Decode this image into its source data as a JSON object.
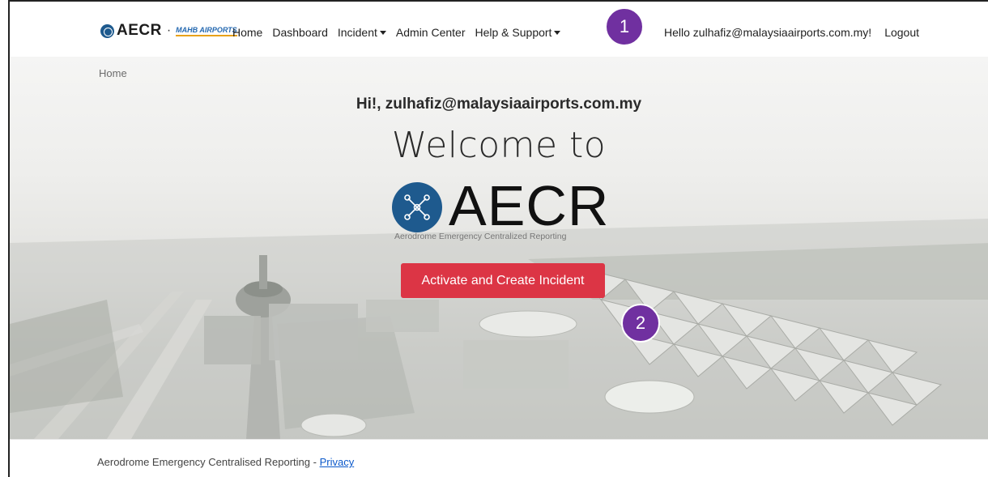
{
  "brand": {
    "name": "AECR",
    "separator": "·",
    "partner": "MAHB AIRPORTS"
  },
  "nav": {
    "home": "Home",
    "dashboard": "Dashboard",
    "incident": "Incident",
    "admin_center": "Admin Center",
    "help_support": "Help & Support"
  },
  "user": {
    "hello": "Hello zulhafiz@malaysiaairports.com.my!",
    "logout": "Logout"
  },
  "markers": {
    "m1": "1",
    "m2": "2"
  },
  "breadcrumb": "Home",
  "hero": {
    "greeting": "Hi!, zulhafiz@malaysiaairports.com.my",
    "welcome": "Welcome to",
    "logo_text": "AECR",
    "logo_subtitle": "Aerodrome Emergency Centralized Reporting",
    "cta": "Activate and Create Incident"
  },
  "footer": {
    "text": "Aerodrome Emergency Centralised Reporting - ",
    "privacy": "Privacy"
  },
  "colors": {
    "brand_blue": "#1e5a8e",
    "cta_red": "#dc3545",
    "marker_purple": "#7030a0",
    "link_blue": "#0a58ca"
  }
}
